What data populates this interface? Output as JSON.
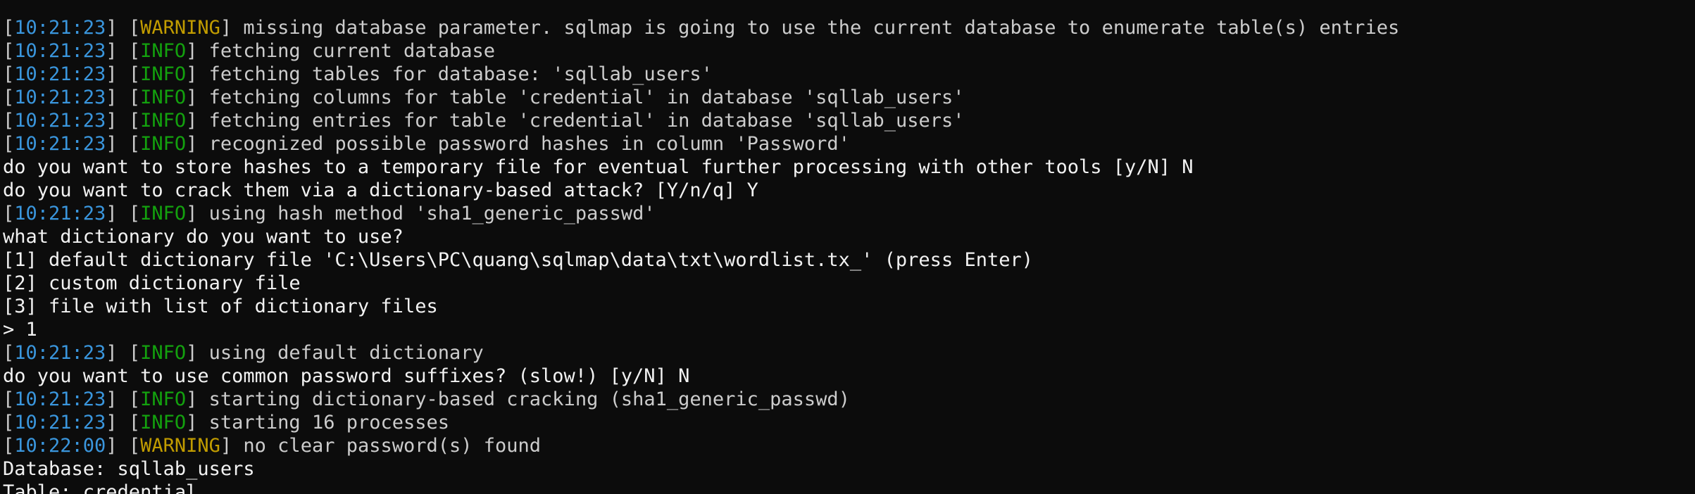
{
  "colors": {
    "background": "#0c0c0c",
    "text": "#cccccc",
    "timestamp": "#3a96dd",
    "info": "#13a10e",
    "warning": "#c19c00",
    "prompt_text": "#f2f2f2"
  },
  "lines": [
    {
      "kind": "plain",
      "text": "            "
    },
    {
      "kind": "log",
      "ts": "10:21:23",
      "level": "WARNING",
      "level_kind": "warning",
      "msg": " missing database parameter. sqlmap is going to use the current database to enumerate table(s) entries"
    },
    {
      "kind": "log",
      "ts": "10:21:23",
      "level": "INFO",
      "level_kind": "info",
      "msg": " fetching current database"
    },
    {
      "kind": "log",
      "ts": "10:21:23",
      "level": "INFO",
      "level_kind": "info",
      "msg": " fetching tables for database: 'sqllab_users'"
    },
    {
      "kind": "log",
      "ts": "10:21:23",
      "level": "INFO",
      "level_kind": "info",
      "msg": " fetching columns for table 'credential' in database 'sqllab_users'"
    },
    {
      "kind": "log",
      "ts": "10:21:23",
      "level": "INFO",
      "level_kind": "info",
      "msg": " fetching entries for table 'credential' in database 'sqllab_users'"
    },
    {
      "kind": "log",
      "ts": "10:21:23",
      "level": "INFO",
      "level_kind": "info",
      "msg": " recognized possible password hashes in column 'Password'"
    },
    {
      "kind": "plain",
      "text": "do you want to store hashes to a temporary file for eventual further processing with other tools [y/N] N"
    },
    {
      "kind": "plain",
      "text": "do you want to crack them via a dictionary-based attack? [Y/n/q] Y"
    },
    {
      "kind": "log",
      "ts": "10:21:23",
      "level": "INFO",
      "level_kind": "info",
      "msg": " using hash method 'sha1_generic_passwd'"
    },
    {
      "kind": "plain",
      "text": "what dictionary do you want to use?"
    },
    {
      "kind": "plain",
      "text": "[1] default dictionary file 'C:\\Users\\PC\\quang\\sqlmap\\data\\txt\\wordlist.tx_' (press Enter)"
    },
    {
      "kind": "plain",
      "text": "[2] custom dictionary file"
    },
    {
      "kind": "plain",
      "text": "[3] file with list of dictionary files"
    },
    {
      "kind": "plain",
      "text": "> 1"
    },
    {
      "kind": "log",
      "ts": "10:21:23",
      "level": "INFO",
      "level_kind": "info",
      "msg": " using default dictionary"
    },
    {
      "kind": "plain",
      "text": "do you want to use common password suffixes? (slow!) [y/N] N"
    },
    {
      "kind": "log",
      "ts": "10:21:23",
      "level": "INFO",
      "level_kind": "info",
      "msg": " starting dictionary-based cracking (sha1_generic_passwd)"
    },
    {
      "kind": "log",
      "ts": "10:21:23",
      "level": "INFO",
      "level_kind": "info",
      "msg": " starting 16 processes"
    },
    {
      "kind": "log",
      "ts": "10:22:00",
      "level": "WARNING",
      "level_kind": "warning",
      "msg": " no clear password(s) found"
    },
    {
      "kind": "plain",
      "text": "Database: sqllab_users"
    },
    {
      "kind": "plain",
      "text": "Table: credential"
    }
  ]
}
